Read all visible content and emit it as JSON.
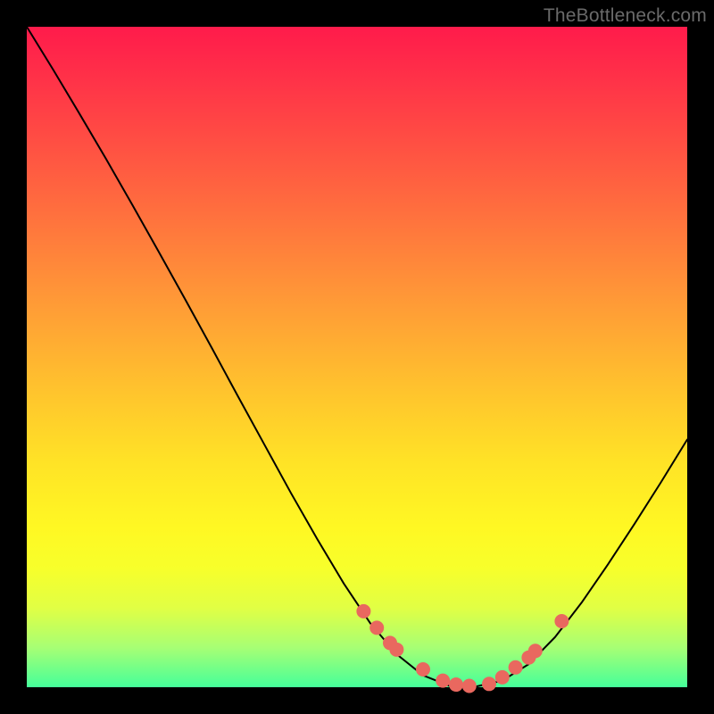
{
  "watermark": "TheBottleneck.com",
  "colors": {
    "background": "#000000",
    "curve_stroke": "#000000",
    "marker_fill": "#e9685f",
    "marker_stroke": "#e9685f"
  },
  "chart_data": {
    "type": "line",
    "title": "",
    "xlabel": "",
    "ylabel": "",
    "xlim": [
      0,
      100
    ],
    "ylim": [
      0,
      100
    ],
    "x": [
      0,
      4,
      8,
      12,
      16,
      20,
      24,
      28,
      32,
      36,
      40,
      44,
      48,
      52,
      56,
      60,
      64,
      68,
      72,
      76,
      80,
      84,
      88,
      92,
      96,
      100
    ],
    "values": [
      100.0,
      93.5,
      86.8,
      80.0,
      73.0,
      65.9,
      58.7,
      51.4,
      44.0,
      36.7,
      29.4,
      22.4,
      15.7,
      9.7,
      5.0,
      1.8,
      0.2,
      0.1,
      1.0,
      3.5,
      7.6,
      12.8,
      18.6,
      24.7,
      31.0,
      37.5
    ],
    "markers": {
      "x": [
        51,
        53,
        55,
        56,
        60,
        63,
        65,
        67,
        70,
        72,
        74,
        76,
        77,
        81
      ],
      "values": [
        11.5,
        9.0,
        6.7,
        5.7,
        2.7,
        1.0,
        0.4,
        0.2,
        0.5,
        1.5,
        3.0,
        4.5,
        5.5,
        10.0
      ]
    }
  }
}
